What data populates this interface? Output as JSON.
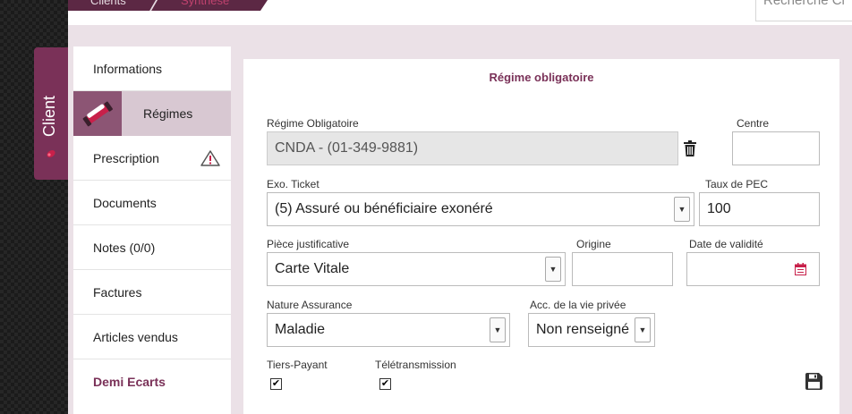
{
  "breadcrumb": {
    "item1": "Clients",
    "item2": "Synthèse"
  },
  "search": {
    "placeholder": "Recherche Cl"
  },
  "client_tab": {
    "label": "Client"
  },
  "sidebar": {
    "items": [
      {
        "label": "Informations"
      },
      {
        "label": "Régimes"
      },
      {
        "label": "Prescription"
      },
      {
        "label": "Documents"
      },
      {
        "label": "Notes (0/0)"
      },
      {
        "label": "Factures"
      },
      {
        "label": "Articles vendus"
      },
      {
        "label": "Demi Ecarts"
      }
    ]
  },
  "panel": {
    "title": "Régime obligatoire",
    "regime_label": "Régime Obligatoire",
    "regime_value": "CNDA - (01-349-9881)",
    "centre_label": "Centre",
    "centre_value": "",
    "exo_label": "Exo. Ticket",
    "exo_value": "(5) Assuré ou bénéficiaire exonéré",
    "taux_label": "Taux de PEC",
    "taux_value": "100",
    "piece_label": "Pièce justificative",
    "piece_value": "Carte Vitale",
    "origine_label": "Origine",
    "origine_value": "",
    "date_label": "Date de validité",
    "date_value": "",
    "nature_label": "Nature Assurance",
    "nature_value": "Maladie",
    "acc_label": "Acc. de la vie privée",
    "acc_value": "Non renseigné",
    "tiers_label": "Tiers-Payant",
    "tiers_checked": true,
    "tele_label": "Télétransmission",
    "tele_checked": true
  },
  "colors": {
    "brand": "#7a3158",
    "brand_light": "#ebe1e7",
    "active_item": "#d8c8d2"
  }
}
